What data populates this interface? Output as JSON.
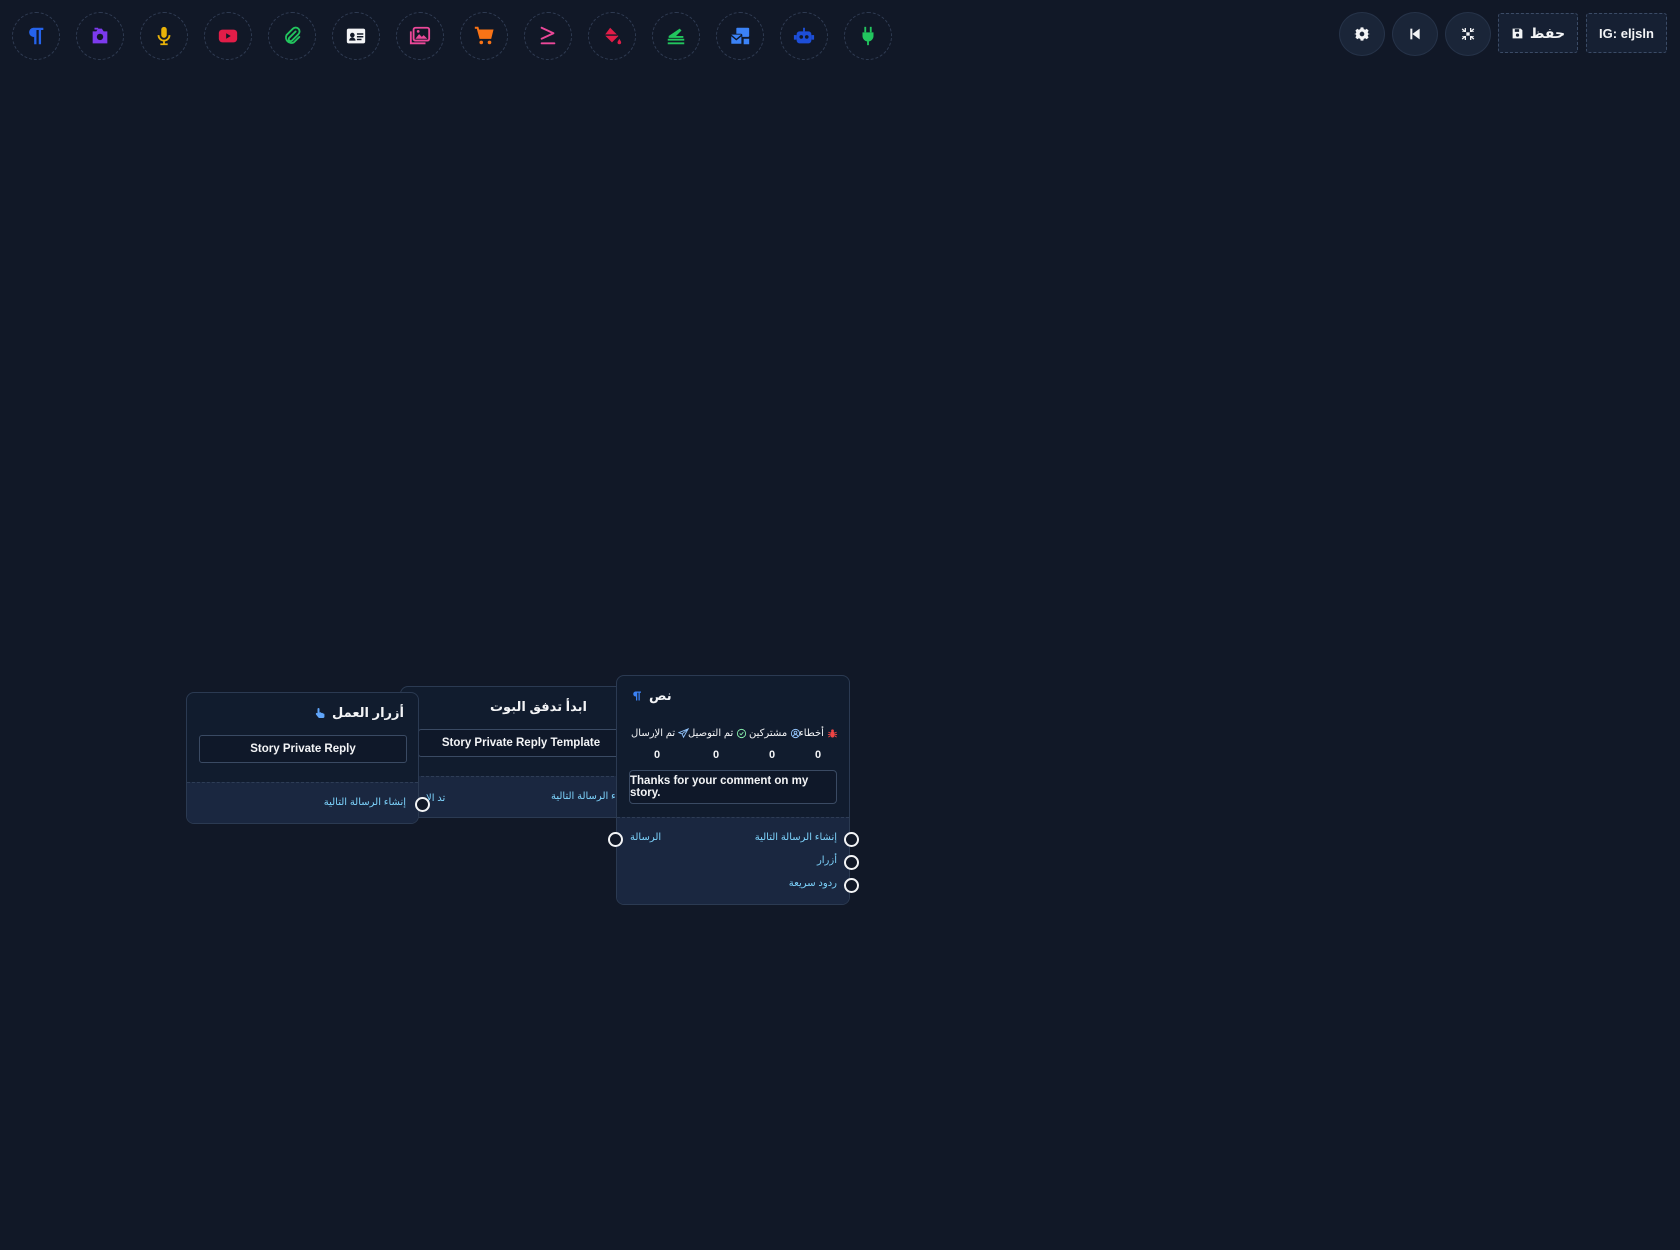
{
  "toolbar": {
    "tools": [
      {
        "name": "text-tool",
        "icon": "paragraph-icon",
        "color": "#2563eb"
      },
      {
        "name": "camera-tool",
        "icon": "camera-icon",
        "color": "#7c3aed"
      },
      {
        "name": "audio-tool",
        "icon": "microphone-icon",
        "color": "#eab308"
      },
      {
        "name": "video-tool",
        "icon": "youtube-icon",
        "color": "#e11d48"
      },
      {
        "name": "file-tool",
        "icon": "paperclip-icon",
        "color": "#22c55e"
      },
      {
        "name": "card-tool",
        "icon": "id-card-icon",
        "color": "#f3f4f6"
      },
      {
        "name": "gallery-tool",
        "icon": "images-icon",
        "color": "#ec4899"
      },
      {
        "name": "ecommerce-tool",
        "icon": "cart-icon",
        "color": "#f97316"
      },
      {
        "name": "condition-tool",
        "icon": "greater-equal-icon",
        "color": "#ec4899"
      },
      {
        "name": "action-tool",
        "icon": "fill-drip-icon",
        "color": "#e11d48"
      },
      {
        "name": "sequence-tool",
        "icon": "stack-icon",
        "color": "#22c55e"
      },
      {
        "name": "broadcast-tool",
        "icon": "mail-bulk-icon",
        "color": "#3b82f6"
      },
      {
        "name": "bot-tool",
        "icon": "robot-icon",
        "color": "#2563eb"
      },
      {
        "name": "plugin-tool",
        "icon": "plug-icon",
        "color": "#22c55e"
      }
    ],
    "settings_icon": "gear-icon",
    "back_icon": "step-backward-icon",
    "fit_icon": "compress-icon",
    "save_label": "حفظ",
    "account_label": "IG: eljsln"
  },
  "nodes": {
    "action_buttons": {
      "title": "أزرار العمل",
      "field": "Story Private Reply",
      "port_label": "إنشاء الرسالة التالية"
    },
    "start_flow": {
      "title": "ابدأ تدفق البوت",
      "field": "Story Private Reply Template",
      "left_port_label": "تد الإ",
      "right_port_label": "إنشاء الرسالة التالية"
    },
    "text": {
      "title": "نص",
      "stats": [
        {
          "label": "أخطاء",
          "value": "0",
          "icon": "bug-icon",
          "color": "#ef4444"
        },
        {
          "label": "مشتركين",
          "value": "0",
          "icon": "user-circle-icon",
          "color": "#93c5fd"
        },
        {
          "label": "تم التوصيل",
          "value": "0",
          "icon": "check-circle-icon",
          "color": "#86efac"
        },
        {
          "label": "تم الإرسال",
          "value": "0",
          "icon": "paper-plane-icon",
          "color": "#93c5fd"
        }
      ],
      "message": "Thanks for your comment on my story.",
      "input_label": "الرسالة",
      "outputs": [
        "إنشاء الرسالة التالية",
        "أزرار",
        "ردود سريعة"
      ]
    }
  }
}
